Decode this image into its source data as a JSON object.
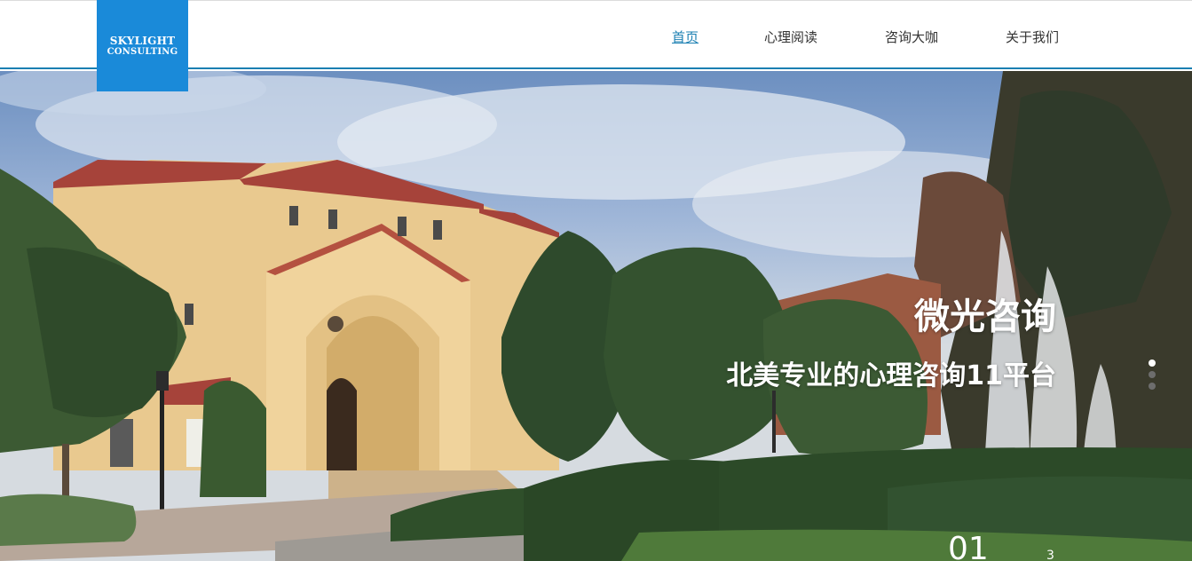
{
  "logo": {
    "line1": "SKYLIGHT",
    "line2": "CONSULTING"
  },
  "nav": {
    "items": [
      {
        "label": "首页",
        "active": true
      },
      {
        "label": "心理阅读",
        "active": false
      },
      {
        "label": "咨询大咖",
        "active": false
      },
      {
        "label": "关于我们",
        "active": false
      }
    ]
  },
  "hero": {
    "title": "微光咨询",
    "subtitle": "北美专业的心理咨询11平台",
    "slide_current": "01",
    "slide_total": "3",
    "dots_count": 3,
    "active_dot": 1
  },
  "colors": {
    "brand": "#1a8ad9",
    "nav_active": "#1a7fb2"
  }
}
